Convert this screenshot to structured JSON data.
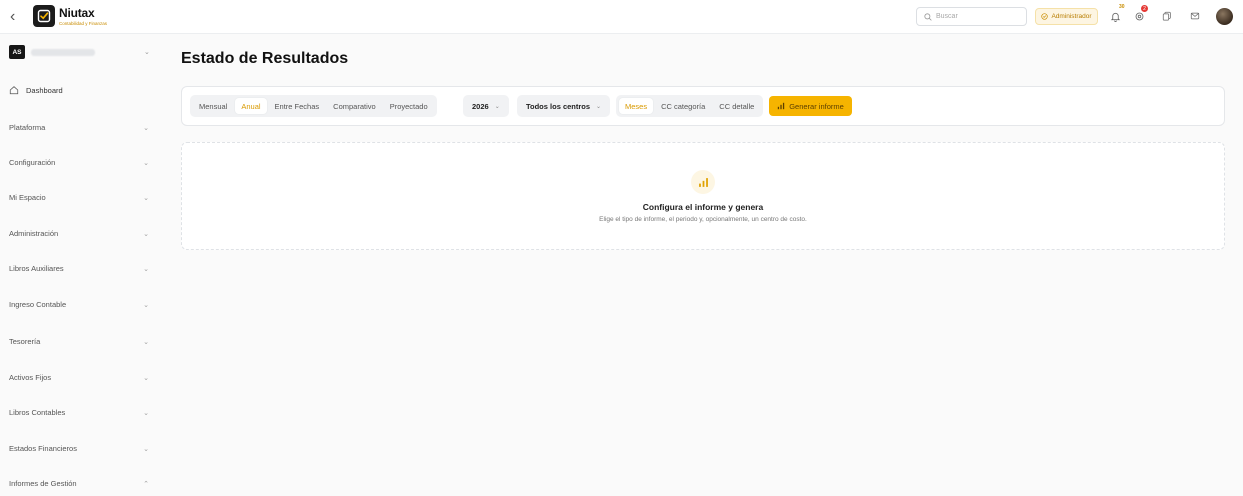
{
  "brand": {
    "name": "Niutax",
    "tagline": "Contabilidad y Finanzas"
  },
  "header": {
    "search_placeholder": "Buscar",
    "role": "Administrador",
    "notifications_count": "30",
    "apps_count": "2"
  },
  "sidebar": {
    "org_initials": "AS",
    "dashboard": "Dashboard",
    "items": [
      {
        "label": "Plataforma",
        "chevron": "⌄"
      },
      {
        "label": "Configuración",
        "chevron": "⌄"
      },
      {
        "label": "Mi Espacio",
        "chevron": "⌄"
      },
      {
        "label": "Administración",
        "chevron": "⌄"
      },
      {
        "label": "Libros Auxiliares",
        "chevron": "⌄"
      },
      {
        "label": "Ingreso Contable",
        "chevron": "⌄"
      },
      {
        "label": "Tesorería",
        "chevron": "⌄"
      },
      {
        "label": "Activos Fijos",
        "chevron": "⌄"
      },
      {
        "label": "Libros Contables",
        "chevron": "⌄"
      },
      {
        "label": "Estados Financieros",
        "chevron": "⌄"
      },
      {
        "label": "Informes de Gestión",
        "chevron": "⌃"
      }
    ]
  },
  "page": {
    "title": "Estado de Resultados"
  },
  "filters": {
    "period_types": [
      "Mensual",
      "Anual",
      "Entre Fechas",
      "Comparativo",
      "Proyectado"
    ],
    "active_period": "Anual",
    "year": "2026",
    "cost_center": "Todos los centros",
    "views": [
      "Meses",
      "CC categoría",
      "CC detalle"
    ],
    "active_view": "Meses",
    "generate_label": "Generar informe"
  },
  "empty_state": {
    "title": "Configura el informe y genera",
    "subtitle": "Elige el tipo de informe, el periodo y, opcionalmente, un centro de costo."
  },
  "colors": {
    "accent": "#f6b400",
    "accent_text": "#d99a00"
  }
}
